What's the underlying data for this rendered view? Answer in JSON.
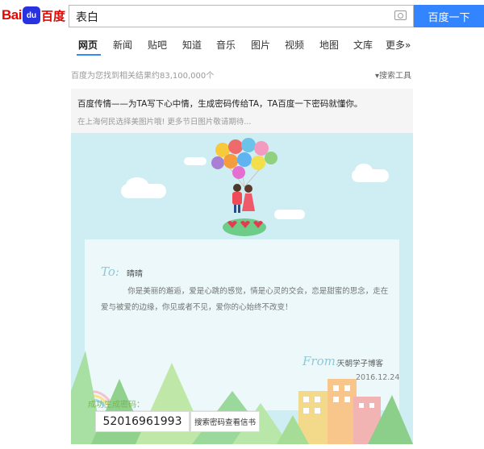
{
  "logo": {
    "bai": "Bai",
    "du": "du",
    "cn": "百度"
  },
  "search": {
    "query": "表白",
    "button_label": "百度一下"
  },
  "nav": {
    "tabs": [
      "网页",
      "新闻",
      "贴吧",
      "知道",
      "音乐",
      "图片",
      "视频",
      "地图",
      "文库",
      "更多»"
    ],
    "active": "网页"
  },
  "results": {
    "count_text": "百度为您找到相关结果约83,100,000个",
    "tools_label": "搜索工具"
  },
  "promo": {
    "line1": "百度传情——为TA写下心中情，生成密码传给TA，TA百度一下密码就懂你。",
    "line2": "在上海何民选择美图片哦! 更多节日图片敬请期待..."
  },
  "letter": {
    "to_label": "To:",
    "to_name": "晴晴",
    "message": "你是美丽的邂逅，爱是心跳的感觉，情是心灵的交会，恋是甜蜜的思念，走在爱与被爱的边缘，你见或者不见，爱你的心始终不改变！",
    "from_label": "From:",
    "from_name": "天朝学子博客",
    "date": "2016.12.24"
  },
  "result_box": {
    "success_label": "成功生成密码：",
    "code": "52016961993",
    "view_button": "搜索密码查看信书"
  },
  "colors": {
    "accent": "#3385ff",
    "brand_red": "#e10601",
    "card_bg": "#cfeef3"
  }
}
